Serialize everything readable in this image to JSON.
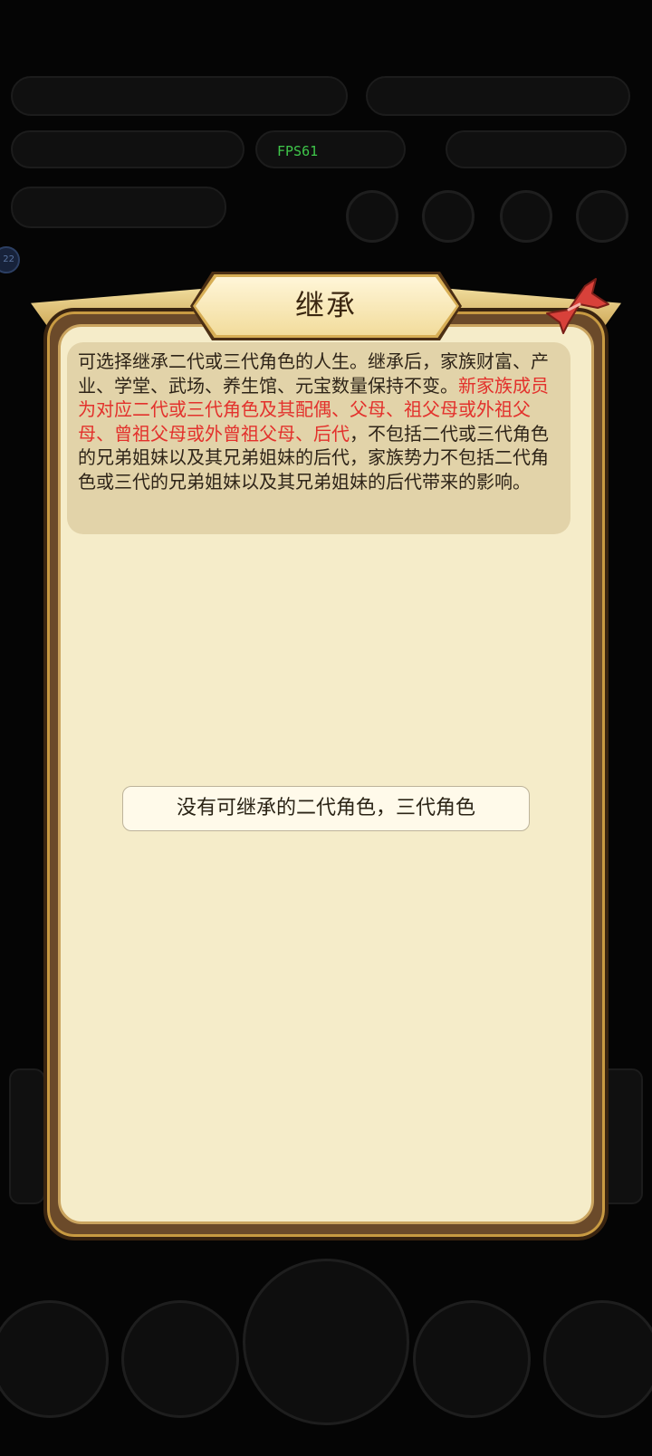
{
  "overlay": {
    "fps": "FPS61",
    "badge": "22"
  },
  "dialog": {
    "title": "继承",
    "info": {
      "part1": "可选择继承二代或三代角色的人生。继承后，家族财富、产业、学堂、武场、养生馆、元宝数量保持不变。",
      "part2_highlight": "新家族成员为对应二代或三代角色及其配偶、父母、祖父母或外祖父母、曾祖父母或外曾祖父母、后代",
      "part3": "，不包括二代或三代角色的兄弟姐妹以及其兄弟姐妹的后代，家族势力不包括二代角色或三代的兄弟姐妹以及其兄弟姐妹的后代带来的影响。"
    },
    "empty_message": "没有可继承的二代角色，三代角色"
  },
  "colors": {
    "highlight_text": "#e3312c",
    "panel_bg": "#f5ecc9",
    "info_bg": "#e2d3a9",
    "close_icon": "#d8413a"
  },
  "icons": {
    "close": "close-icon"
  }
}
